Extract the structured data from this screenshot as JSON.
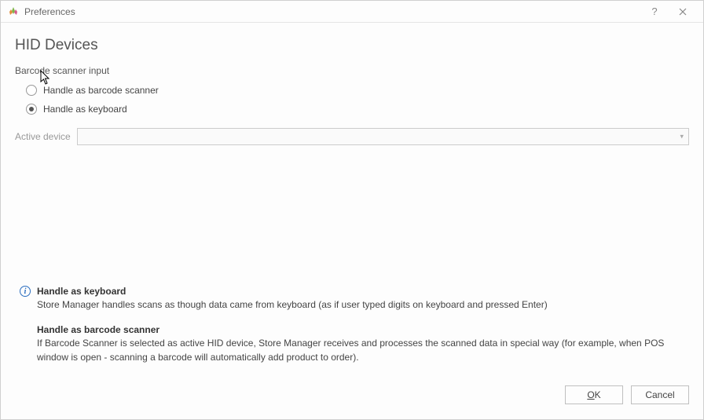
{
  "window": {
    "title": "Preferences"
  },
  "page": {
    "title": "HID Devices",
    "section_label": "Barcode scanner input",
    "radios": {
      "barcode": "Handle as barcode scanner",
      "keyboard": "Handle as keyboard",
      "selected": "keyboard"
    },
    "active_device_label": "Active device",
    "active_device_value": ""
  },
  "info": {
    "keyboard_title": "Handle as keyboard",
    "keyboard_desc": "Store Manager handles scans as though data came from keyboard (as if user typed digits on keyboard and pressed Enter)",
    "barcode_title": "Handle as barcode scanner",
    "barcode_desc": "If Barcode Scanner is selected as active HID device, Store Manager receives and processes the scanned data in special way (for example, when POS window is open - scanning a barcode will automatically add product to order)."
  },
  "footer": {
    "ok": "OK",
    "cancel": "Cancel"
  }
}
